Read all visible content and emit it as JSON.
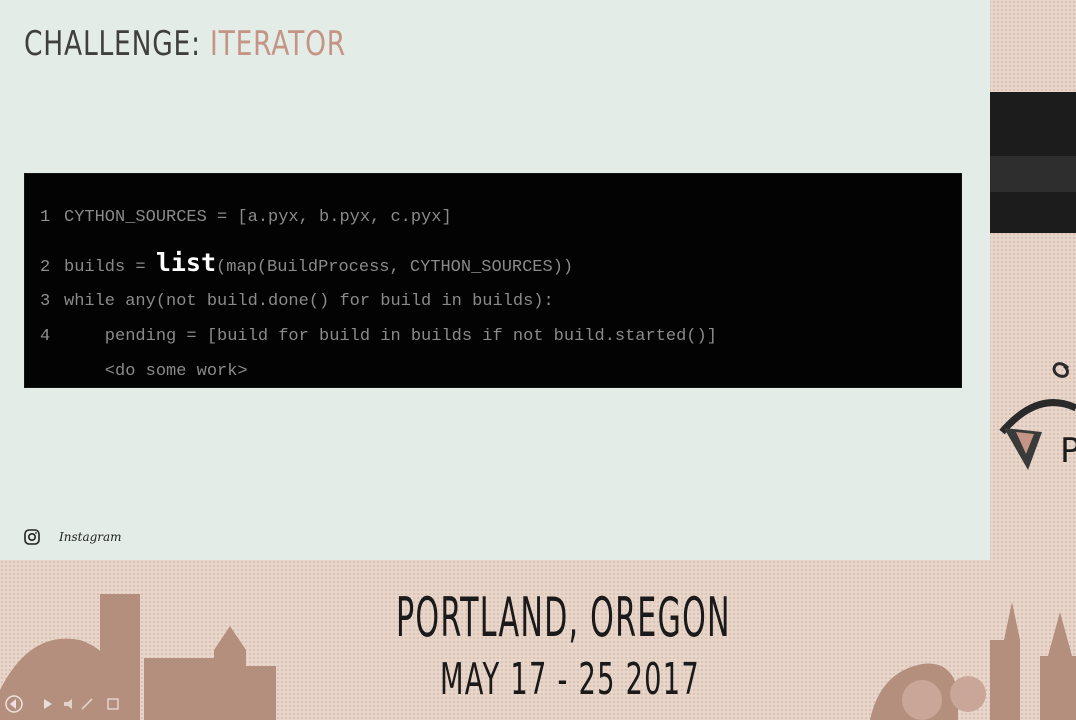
{
  "slide": {
    "title_prefix": "CHALLENGE:",
    "title_highlight": "ITERATOR",
    "colors": {
      "background": "#e3ece7",
      "title": "#3f3f3f",
      "accent": "#c49484",
      "code_bg": "#030303"
    },
    "code": [
      {
        "num": "1",
        "pre": "CYTHON_SOURCES = [a.pyx, b.pyx, c.pyx]",
        "hl": "",
        "post": ""
      },
      {
        "num": "2",
        "pre": "builds = ",
        "hl": "list",
        "post": "(map(BuildProcess, CYTHON_SOURCES))"
      },
      {
        "num": "3",
        "pre": "while any(not build.done() for build in builds):",
        "hl": "",
        "post": ""
      },
      {
        "num": "4",
        "pre": "    pending = [build for build in builds if not build.started()]",
        "hl": "",
        "post": ""
      },
      {
        "num": "",
        "pre": "    <do some work>",
        "hl": "",
        "post": ""
      }
    ],
    "footer": {
      "icon": "instagram-icon",
      "label": "Instagram"
    }
  },
  "event": {
    "city": "PORTLAND, OREGON",
    "dates": "MAY 17 - 25 2017",
    "logo_letter": "P",
    "colors": {
      "skyline": "#b48f7d",
      "backdrop": "#e9d6cb"
    }
  },
  "player": {
    "controls": [
      "rewind-icon",
      "play-icon",
      "volume-icon",
      "pen-icon",
      "settings-icon"
    ]
  }
}
